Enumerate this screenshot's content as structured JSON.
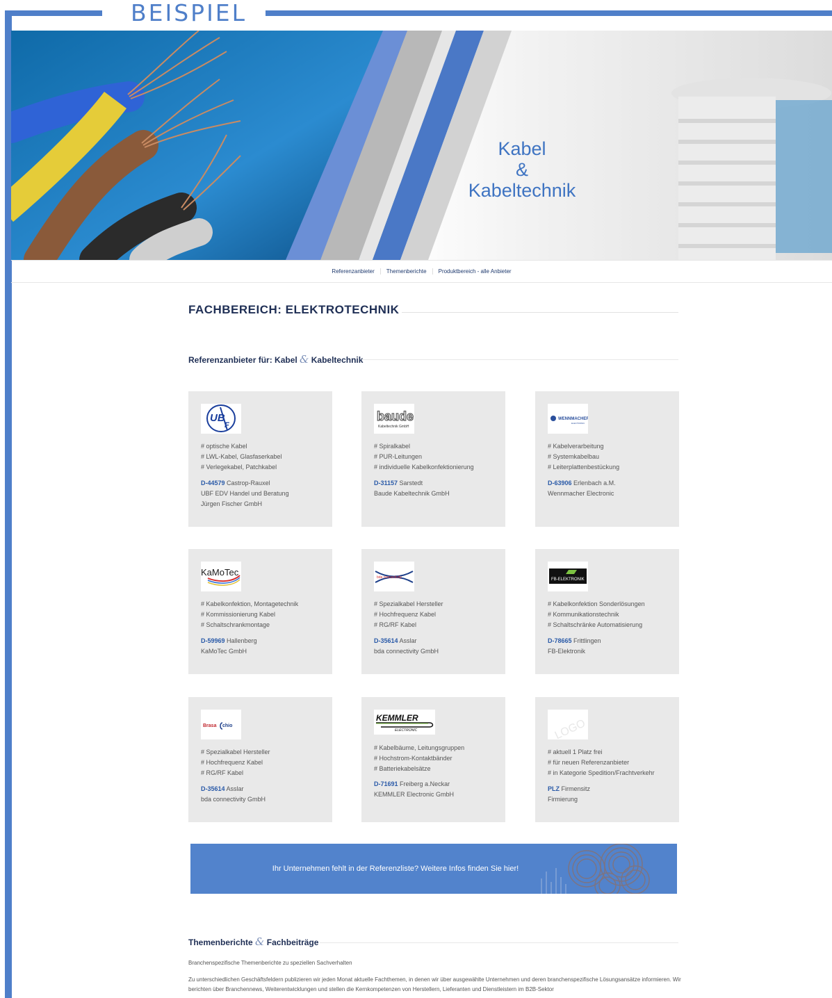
{
  "stamp": "BEISPIEL",
  "hero": {
    "line1": "Kabel",
    "line2": "&",
    "line3": "Kabeltechnik"
  },
  "nav": [
    "Referenzanbieter",
    "Themenberichte",
    "Produktbereich - alle Anbieter"
  ],
  "section_title": "FACHBEREICH: ELEKTROTECHNIK",
  "ref_title": {
    "prefix": "Referenzanbieter für: Kabel",
    "amp": "&",
    "suffix": "Kabeltechnik"
  },
  "cards": [
    {
      "logo": "UBF",
      "tags": [
        "# optische Kabel",
        "# LWL-Kabel, Glasfaserkabel",
        "# Verlegekabel, Patchkabel"
      ],
      "zip": "D-44579",
      "city": "Castrop-Rauxel",
      "lines": [
        "UBF EDV Handel und Beratung",
        "Jürgen Fischer GmbH"
      ]
    },
    {
      "logo": "baude",
      "tags": [
        "# Spiralkabel",
        "# PUR-Leitungen",
        "# individuelle Kabelkonfektionierung"
      ],
      "zip": "D-31157",
      "city": "Sarstedt",
      "lines": [
        "Baude Kabeltechnik GmbH"
      ]
    },
    {
      "logo": "WENNMACHER",
      "tags": [
        "# Kabelverarbeitung",
        "# Systemkabelbau",
        "# Leiterplattenbestückung"
      ],
      "zip": "D-63906",
      "city": "Erlenbach a.M.",
      "lines": [
        "Wennmacher Electronic"
      ]
    },
    {
      "logo": "KaMoTec",
      "tags": [
        "# Kabelkonfektion, Montagetechnik",
        "# Kommissionierung Kabel",
        "# Schaltschrankmontage"
      ],
      "zip": "D-59969",
      "city": "Hallenberg",
      "lines": [
        "KaMoTec GmbH"
      ]
    },
    {
      "logo": "bda",
      "tags": [
        "# Spezialkabel Hersteller",
        "# Hochfrequenz Kabel",
        "# RG/RF Kabel"
      ],
      "zip": "D-35614",
      "city": "Asslar",
      "lines": [
        "bda connectivity GmbH"
      ]
    },
    {
      "logo": "FB-ELEKTRONIK",
      "tags": [
        "# Kabelkonfektion Sonderlösungen",
        "# Kommunikationstechnik",
        "# Schaltschränke Automatisierung"
      ],
      "zip": "D-78665",
      "city": "Frittlingen",
      "lines": [
        "FB-Elektronik"
      ]
    },
    {
      "logo": "Brasacchio",
      "tags": [
        "# Spezialkabel Hersteller",
        "# Hochfrequenz Kabel",
        "# RG/RF Kabel"
      ],
      "zip": "D-35614",
      "city": "Asslar",
      "lines": [
        "bda connectivity GmbH"
      ]
    },
    {
      "logo": "KEMMLER",
      "tags": [
        "# Kabelbäume, Leitungsgruppen",
        "# Hochstrom-Kontaktbänder",
        "# Batteriekabelsätze"
      ],
      "zip": "D-71691",
      "city": "Freiberg a.Neckar",
      "lines": [
        "KEMMLER Electronic GmbH"
      ]
    },
    {
      "logo": "LOGO",
      "tags": [
        "# aktuell 1 Platz frei",
        "# für neuen Referenzanbieter",
        "# in Kategorie Spedition/Frachtverkehr"
      ],
      "zip": "PLZ",
      "city": "Firmensitz",
      "lines": [
        "Firmierung"
      ]
    }
  ],
  "cta": "Ihr Unternehmen fehlt in der Referenzliste? Weitere Infos finden Sie hier!",
  "themen_title": {
    "prefix": "Themenberichte",
    "amp": "&",
    "suffix": "Fachbeiträge"
  },
  "themen_intro": "Branchenspezifische Themenberichte zu speziellen Sachverhalten",
  "themen_body": "Zu unterschiedlichen Geschäftsfeldern publizieren wir jeden Monat aktuelle Fachthemen, in denen wir über ausgewählte Unternehmen und deren branchenspezifische Lösungsansätze informieren. Wir berichten über Branchennews, Weiterentwicklungen und stellen die Kernkompetenzen von Herstellern, Lieferanten und Dienstleistern im B2B-Sektor"
}
